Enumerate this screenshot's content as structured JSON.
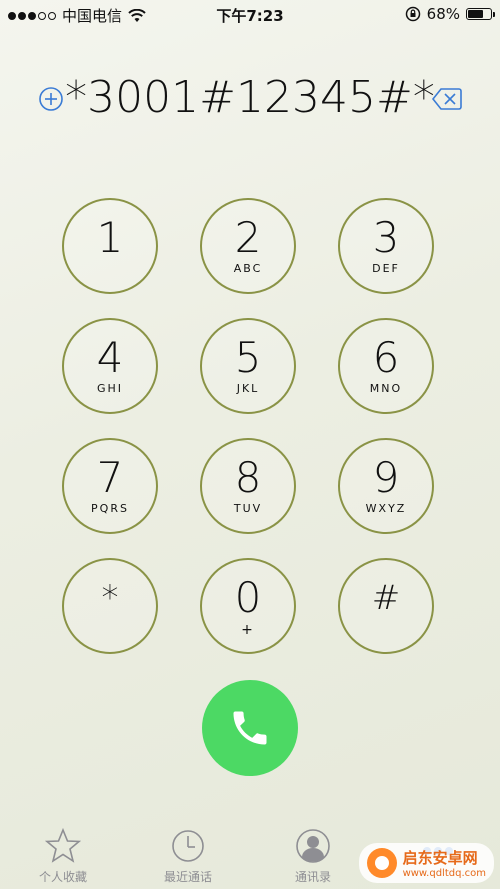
{
  "status_bar": {
    "signal_dots_filled": 3,
    "signal_dots_total": 5,
    "carrier": "中国电信",
    "time": "下午7:23",
    "battery_percent": "68%",
    "battery_level": 0.68
  },
  "dialer": {
    "number": "*3001#12345#*"
  },
  "keypad": [
    {
      "digit": "1",
      "letters": ""
    },
    {
      "digit": "2",
      "letters": "ABC"
    },
    {
      "digit": "3",
      "letters": "DEF"
    },
    {
      "digit": "4",
      "letters": "GHI"
    },
    {
      "digit": "5",
      "letters": "JKL"
    },
    {
      "digit": "6",
      "letters": "MNO"
    },
    {
      "digit": "7",
      "letters": "PQRS"
    },
    {
      "digit": "8",
      "letters": "TUV"
    },
    {
      "digit": "9",
      "letters": "WXYZ"
    },
    {
      "digit": "*",
      "letters": ""
    },
    {
      "digit": "0",
      "letters": "+"
    },
    {
      "digit": "#",
      "letters": ""
    }
  ],
  "tabs": {
    "favorites": "个人收藏",
    "recents": "最近通话",
    "contacts": "通讯录"
  },
  "watermark": {
    "title": "启东安卓网",
    "url": "www.qdltdq.com"
  },
  "colors": {
    "accent": "#3a7bd5",
    "key_ring": "#8a9346",
    "call_green": "#4cd964"
  }
}
